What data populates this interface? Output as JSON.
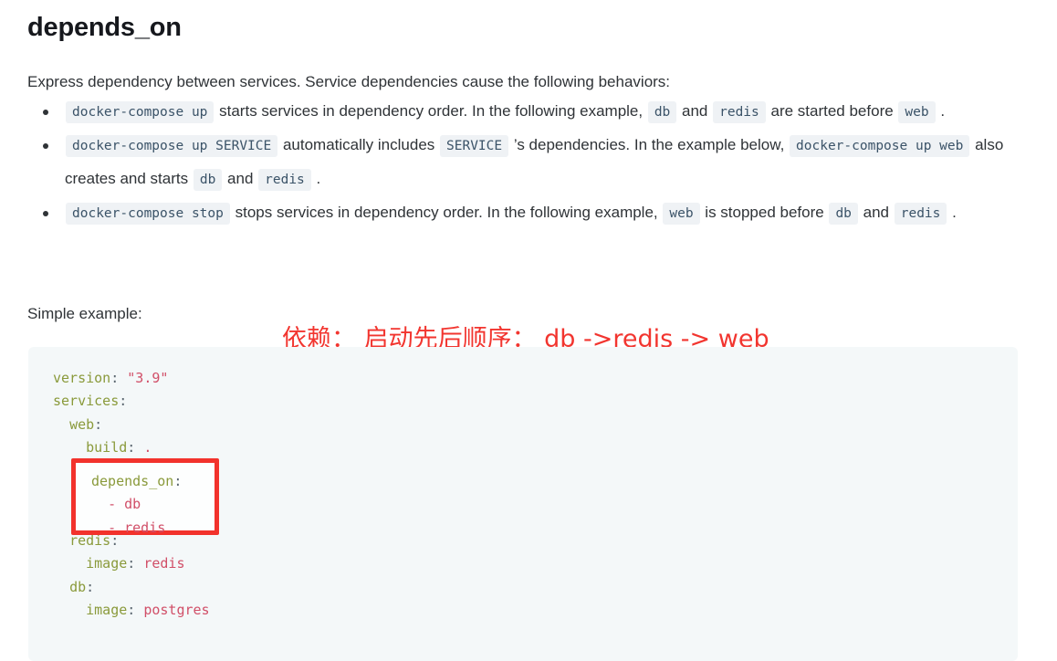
{
  "heading": "depends_on",
  "intro": "Express dependency between services. Service dependencies cause the following behaviors:",
  "bullets": [
    {
      "parts": [
        {
          "type": "code",
          "text": "docker-compose up"
        },
        {
          "type": "text",
          "text": " starts services in dependency order. In the following example, "
        },
        {
          "type": "code",
          "text": "db"
        },
        {
          "type": "text",
          "text": " and "
        },
        {
          "type": "code",
          "text": "redis"
        },
        {
          "type": "text",
          "text": " are started before "
        },
        {
          "type": "code",
          "text": "web"
        },
        {
          "type": "text",
          "text": " ."
        }
      ]
    },
    {
      "parts": [
        {
          "type": "code",
          "text": "docker-compose up SERVICE"
        },
        {
          "type": "text",
          "text": " automatically includes "
        },
        {
          "type": "code",
          "text": "SERVICE"
        },
        {
          "type": "text",
          "text": " ’s dependencies. In the example below, "
        },
        {
          "type": "code",
          "text": "docker-compose up web"
        },
        {
          "type": "text",
          "text": " also creates and starts "
        },
        {
          "type": "code",
          "text": "db"
        },
        {
          "type": "text",
          "text": " and "
        },
        {
          "type": "code",
          "text": "redis"
        },
        {
          "type": "text",
          "text": " ."
        }
      ]
    },
    {
      "parts": [
        {
          "type": "code",
          "text": "docker-compose stop"
        },
        {
          "type": "text",
          "text": " stops services in dependency order. In the following example, "
        },
        {
          "type": "code",
          "text": "web"
        },
        {
          "type": "text",
          "text": " is stopped before "
        },
        {
          "type": "code",
          "text": "db"
        },
        {
          "type": "text",
          "text": " and "
        },
        {
          "type": "code",
          "text": "redis"
        },
        {
          "type": "text",
          "text": " ."
        }
      ]
    }
  ],
  "simple_example_label": "Simple example:",
  "annotation": {
    "text": "依赖： 启动先后顺序： db ->redis -> web",
    "color": "#f2352f"
  },
  "code": {
    "language": "yaml",
    "lines": [
      [
        {
          "c": "k",
          "t": "version"
        },
        {
          "c": "p",
          "t": ": "
        },
        {
          "c": "v",
          "t": "\"3.9\""
        }
      ],
      [
        {
          "c": "k",
          "t": "services"
        },
        {
          "c": "p",
          "t": ":"
        }
      ],
      [
        {
          "c": "p",
          "t": "  "
        },
        {
          "c": "k",
          "t": "web"
        },
        {
          "c": "p",
          "t": ":"
        }
      ],
      [
        {
          "c": "p",
          "t": "    "
        },
        {
          "c": "k",
          "t": "build"
        },
        {
          "c": "p",
          "t": ": "
        },
        {
          "c": "v",
          "t": "."
        }
      ],
      [
        {
          "c": "p",
          "t": "    "
        },
        {
          "c": "k",
          "t": "depends_on"
        },
        {
          "c": "p",
          "t": ":"
        }
      ],
      [
        {
          "c": "p",
          "t": "      "
        },
        {
          "c": "dash",
          "t": "- "
        },
        {
          "c": "v",
          "t": "db"
        }
      ],
      [
        {
          "c": "p",
          "t": "      "
        },
        {
          "c": "dash",
          "t": "- "
        },
        {
          "c": "v",
          "t": "redis"
        }
      ],
      [
        {
          "c": "p",
          "t": "  "
        },
        {
          "c": "k",
          "t": "redis"
        },
        {
          "c": "p",
          "t": ":"
        }
      ],
      [
        {
          "c": "p",
          "t": "    "
        },
        {
          "c": "k",
          "t": "image"
        },
        {
          "c": "p",
          "t": ": "
        },
        {
          "c": "v",
          "t": "redis"
        }
      ],
      [
        {
          "c": "p",
          "t": "  "
        },
        {
          "c": "k",
          "t": "db"
        },
        {
          "c": "p",
          "t": ":"
        }
      ],
      [
        {
          "c": "p",
          "t": "    "
        },
        {
          "c": "k",
          "t": "image"
        },
        {
          "c": "p",
          "t": ": "
        },
        {
          "c": "v",
          "t": "postgres"
        }
      ]
    ]
  },
  "highlight_box": {
    "color": "#f2322c",
    "lines": [
      [
        {
          "c": "k",
          "t": "depends_on"
        },
        {
          "c": "p",
          "t": ":"
        }
      ],
      [
        {
          "c": "p",
          "t": "  "
        },
        {
          "c": "dash",
          "t": "- "
        },
        {
          "c": "v",
          "t": "db"
        }
      ],
      [
        {
          "c": "p",
          "t": "  "
        },
        {
          "c": "dash",
          "t": "- "
        },
        {
          "c": "v",
          "t": "redis"
        }
      ]
    ]
  }
}
